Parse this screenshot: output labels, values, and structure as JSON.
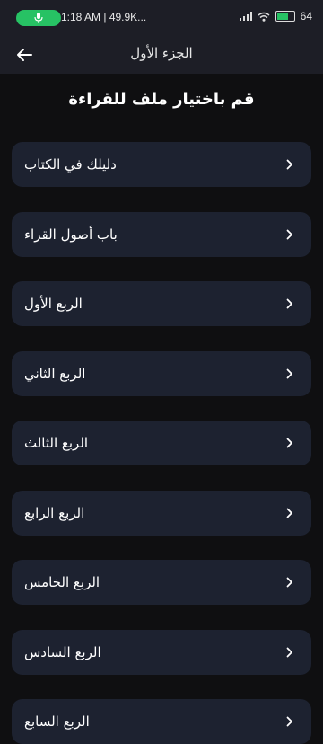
{
  "status_bar": {
    "time_network": "1:18 AM | 49.9K...",
    "battery_percent": "64",
    "battery_level": 0.64,
    "colors": {
      "mic_pill": "#27c264"
    }
  },
  "app_bar": {
    "title": "الجزء الأول"
  },
  "prompt": "قم باختيار ملف للقراءة",
  "items": [
    {
      "label": "دليلك في الكتاب"
    },
    {
      "label": "باب أصول القراء"
    },
    {
      "label": "الربع الأول"
    },
    {
      "label": "الربع الثاني"
    },
    {
      "label": "الربع الثالث"
    },
    {
      "label": "الربع الرابع"
    },
    {
      "label": "الربع الخامس"
    },
    {
      "label": "الربع السادس"
    },
    {
      "label": "الربع السابع"
    }
  ],
  "colors": {
    "background": "#0f0f11",
    "bar": "#1d1e26",
    "card": "#1d2230",
    "text": "#ffffff"
  }
}
